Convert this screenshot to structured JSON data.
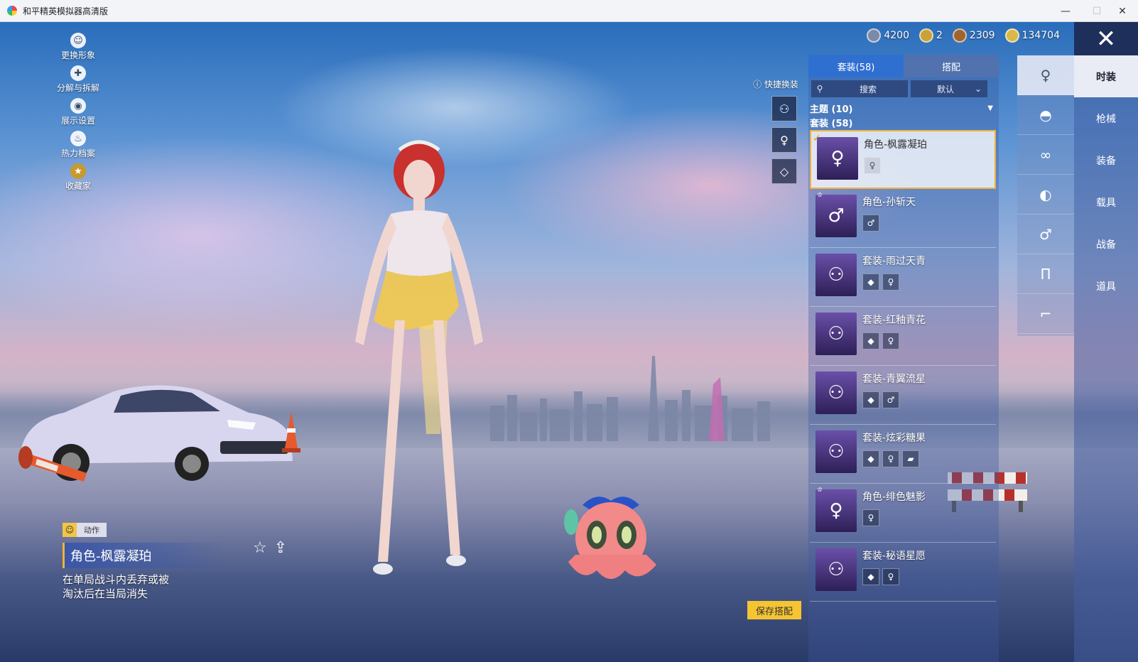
{
  "window": {
    "title": "和平精英模拟器高清版",
    "controls": {
      "minimize": "—",
      "maximize": "☐",
      "close": "✕"
    }
  },
  "left_menu": [
    {
      "label": "更换形象",
      "icon": "person-icon"
    },
    {
      "label": "分解与拆解",
      "icon": "puzzle-icon"
    },
    {
      "label": "展示设置",
      "icon": "eye-icon"
    },
    {
      "label": "热力档案",
      "icon": "flame-icon"
    },
    {
      "label": "收藏家",
      "icon": "medal-icon"
    }
  ],
  "currency": [
    {
      "value": "4200",
      "color": "#7a8aa8"
    },
    {
      "value": "2",
      "color": "#c8a23c"
    },
    {
      "value": "2309",
      "color": "#a0642e"
    },
    {
      "value": "134704",
      "color": "#d9b84a"
    }
  ],
  "close_label": "✕",
  "right_tabs": [
    "时装",
    "枪械",
    "装备",
    "载具",
    "战备",
    "道具"
  ],
  "category_icons": [
    "person-icon",
    "cap-icon",
    "glasses-icon",
    "mask-icon",
    "body-icon",
    "pants-icon",
    "shoes-icon"
  ],
  "panel": {
    "tabs": [
      "套装(58)",
      "搭配"
    ],
    "search_label": "搜索",
    "sort_label": "默认",
    "theme_label": "主题 (10)",
    "set_count_label": "套装 (58)",
    "items": [
      {
        "name": "角色-枫露凝珀",
        "selected": true,
        "parts": 1
      },
      {
        "name": "角色-孙斩天",
        "selected": false,
        "parts": 1
      },
      {
        "name": "套装-雨过天青",
        "selected": false,
        "parts": 2
      },
      {
        "name": "套装-红釉青花",
        "selected": false,
        "parts": 2
      },
      {
        "name": "套装-青翼流星",
        "selected": false,
        "parts": 2
      },
      {
        "name": "套装-炫彩糖果",
        "selected": false,
        "parts": 3
      },
      {
        "name": "角色-绯色魅影",
        "selected": false,
        "parts": 1
      },
      {
        "name": "套装-秘语星愿",
        "selected": false,
        "parts": 2
      }
    ]
  },
  "quick_change": {
    "title": "快捷换装"
  },
  "outfit_info": {
    "action_label": "动作",
    "name": "角色-枫露凝珀",
    "description_line1": "在单局战斗内丢弃或被",
    "description_line2": "淘汰后在当局消失"
  },
  "save_button": "保存搭配",
  "colors": {
    "accent_gold": "#f0b23a",
    "tab_active_blue": "#2f6fd0",
    "save_yellow": "#f5c431"
  }
}
